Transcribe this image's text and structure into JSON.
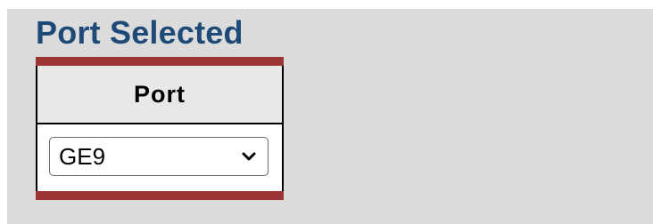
{
  "section": {
    "title": "Port Selected"
  },
  "table": {
    "header": "Port",
    "select": {
      "value": "GE9",
      "icon": "chevron-down-icon"
    }
  },
  "colors": {
    "title": "#1e4a78",
    "bar": "#9b3535",
    "panel": "#dcdcdc",
    "header_bg": "#e8e8e8"
  }
}
